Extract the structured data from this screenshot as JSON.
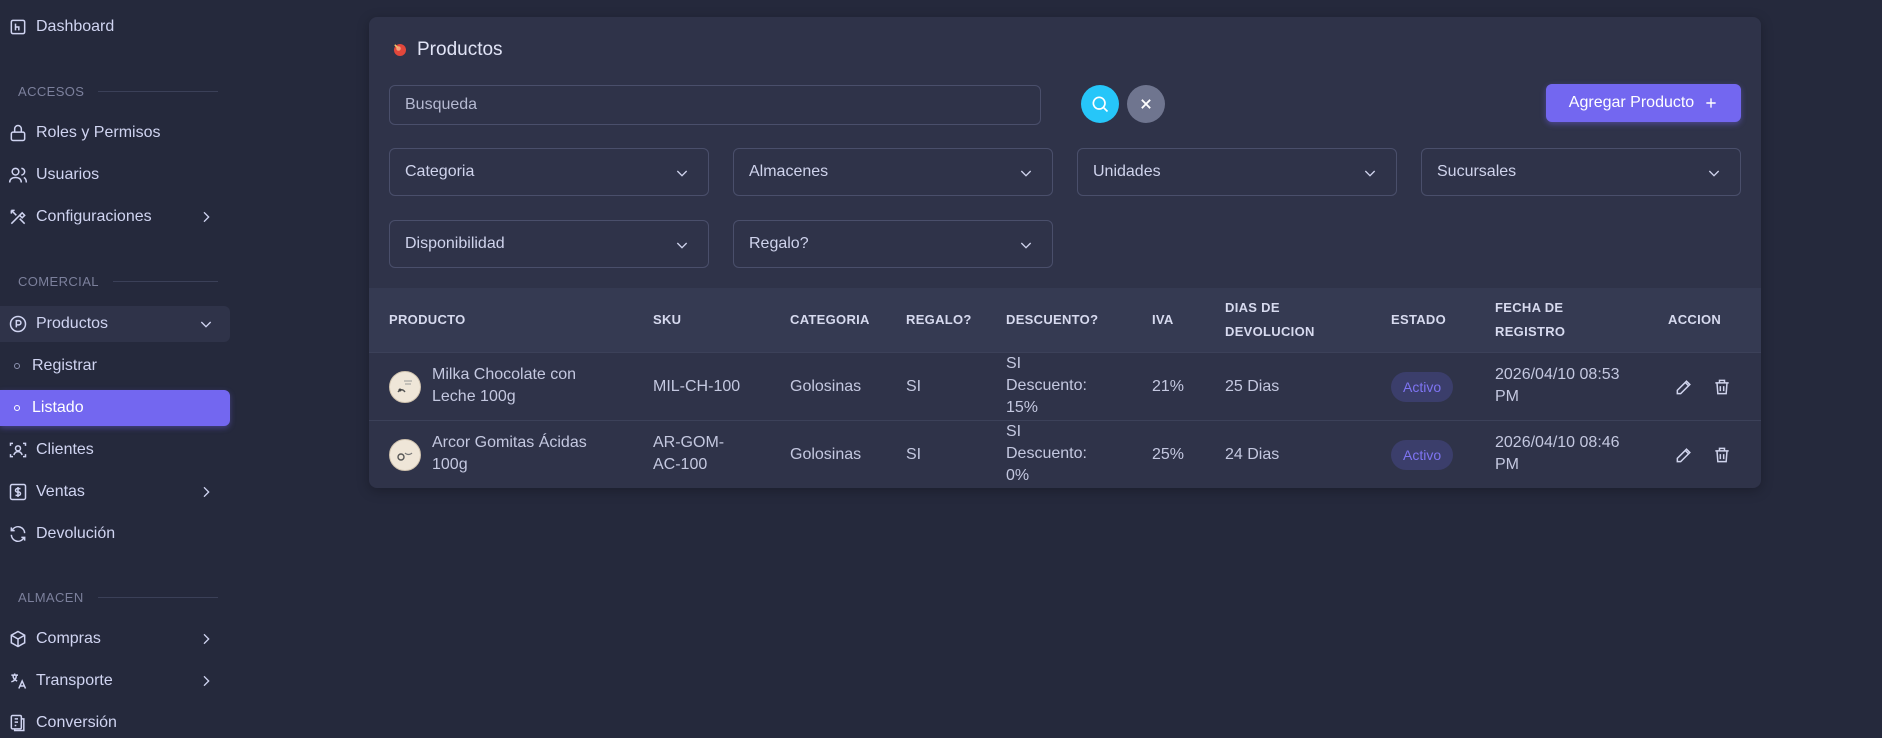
{
  "sidebar": {
    "dashboard": "Dashboard",
    "sections": {
      "accesos": "ACCESOS",
      "comercial": "COMERCIAL",
      "almacen": "ALMACEN"
    },
    "roles": "Roles y Permisos",
    "usuarios": "Usuarios",
    "configuraciones": "Configuraciones",
    "productos": "Productos",
    "registrar": "Registrar",
    "listado": "Listado",
    "clientes": "Clientes",
    "ventas": "Ventas",
    "devolucion": "Devolución",
    "compras": "Compras",
    "transporte": "Transporte",
    "conversion": "Conversión"
  },
  "card": {
    "title": "Productos",
    "search_placeholder": "Busqueda",
    "add_label": "Agregar Producto",
    "filters": {
      "categoria": "Categoria",
      "almacenes": "Almacenes",
      "unidades": "Unidades",
      "sucursales": "Sucursales",
      "disponibilidad": "Disponibilidad",
      "regalo": "Regalo?"
    }
  },
  "table": {
    "headers": {
      "producto": "PRODUCTO",
      "sku": "SKU",
      "categoria": "CATEGORIA",
      "regalo": "REGALO?",
      "descuento": "DESCUENTO?",
      "iva": "IVA",
      "dias_1": "DIAS DE",
      "dias_2": "DEVOLUCION",
      "estado": "ESTADO",
      "fecha_1": "FECHA DE",
      "fecha_2": "REGISTRO",
      "accion": "ACCION"
    },
    "rows": [
      {
        "producto_1": "Milka Chocolate con",
        "producto_2": "Leche 100g",
        "sku_1": "MIL-CH-100",
        "sku_2": "",
        "categoria": "Golosinas",
        "regalo": "SI",
        "desc_1": "SI",
        "desc_2": "Descuento:",
        "desc_3": "15%",
        "iva": "21%",
        "dias": "25 Dias",
        "estado": "Activo",
        "fecha_1": "2026/04/10 08:53",
        "fecha_2": "PM"
      },
      {
        "producto_1": "Arcor Gomitas Ácidas",
        "producto_2": "100g",
        "sku_1": "AR-GOM-",
        "sku_2": "AC-100",
        "categoria": "Golosinas",
        "regalo": "SI",
        "desc_1": "SI",
        "desc_2": "Descuento:",
        "desc_3": "0%",
        "iva": "25%",
        "dias": "24 Dias",
        "estado": "Activo",
        "fecha_1": "2026/04/10 08:46",
        "fecha_2": "PM"
      }
    ]
  },
  "colors": {
    "accent": "#7367f0",
    "info": "#26c6f9",
    "background": "#25293c",
    "card": "#2f3349"
  }
}
